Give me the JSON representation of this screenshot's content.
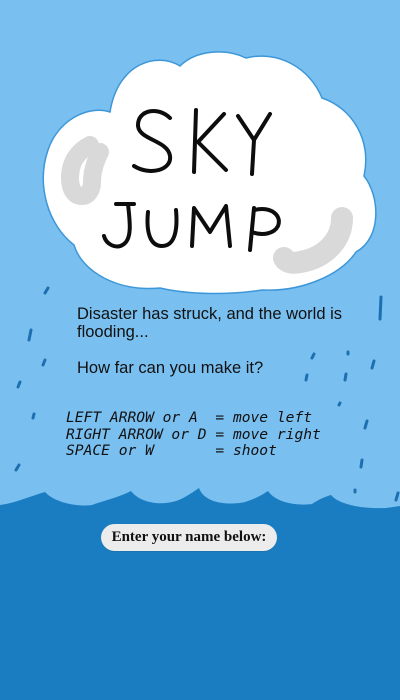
{
  "game": {
    "title_line1": "SKY",
    "title_line2": "JUMP",
    "intro_line1": "Disaster has struck, and the world is flooding...",
    "intro_line2": "How far can you make it?",
    "controls": [
      {
        "keys": "LEFT ARROW or A ",
        "action": "move left"
      },
      {
        "keys": "RIGHT ARROW or D",
        "action": "move right"
      },
      {
        "keys": "SPACE or W      ",
        "action": "shoot"
      }
    ],
    "name_prompt": "Enter your name below:"
  },
  "colors": {
    "sky": "#79bff0",
    "water": "#1a7dc2",
    "cloud": "#ffffff",
    "cloud_shadow": "#d9d9d9",
    "rain": "#1e6fb0"
  }
}
